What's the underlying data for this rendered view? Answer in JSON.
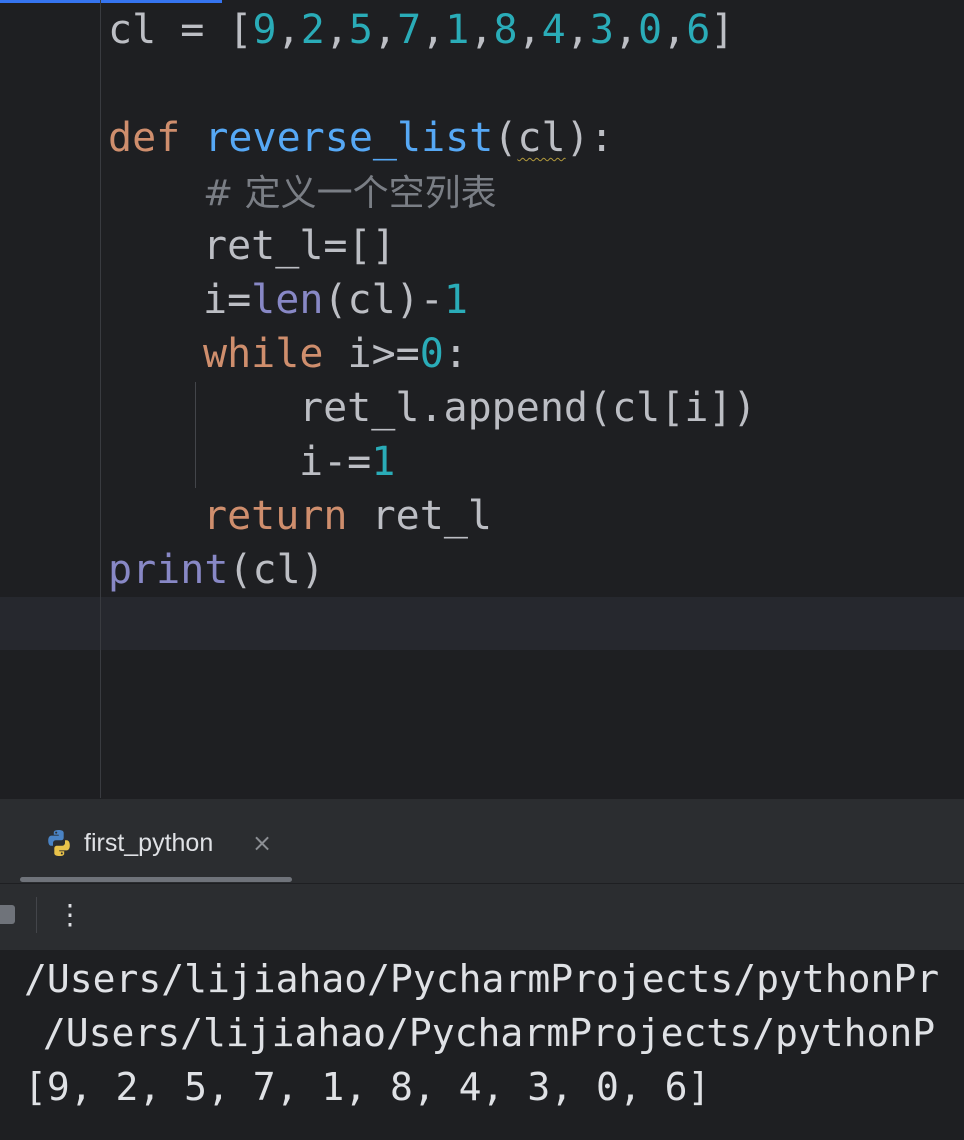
{
  "editor": {
    "line1": {
      "var": "cl",
      "op": " = ",
      "open": "[",
      "items": [
        "9",
        "2",
        "5",
        "7",
        "1",
        "8",
        "4",
        "3",
        "0",
        "6"
      ],
      "sep": ",",
      "close": "]"
    },
    "line2": {
      "kw": "def",
      "name": "reverse_list",
      "open": "(",
      "param": "cl",
      "close": "):"
    },
    "line3": {
      "comment": "# 定义一个空列表"
    },
    "line4": {
      "text": "ret_l=[]"
    },
    "line5": {
      "prefix": "i=",
      "builtin": "len",
      "mid": "(cl)-",
      "num": "1"
    },
    "line6": {
      "kw": "while",
      "mid": " i>=",
      "num": "0",
      "end": ":"
    },
    "line7": {
      "text": "ret_l.append(cl[i])"
    },
    "line8": {
      "prefix": "i-=",
      "num": "1"
    },
    "line9": {
      "kw": "return",
      "rest": " ret_l"
    },
    "line10": {
      "builtin": "print",
      "rest": "(cl)"
    }
  },
  "run_panel": {
    "tab_label": "first_python",
    "close_glyph": "×",
    "more_glyph": "⋮",
    "icons": [
      "python-icon",
      "close-icon",
      "stop-icon",
      "more-vertical-icon"
    ]
  },
  "console": {
    "lines": [
      "/Users/lijiahao/PycharmProjects/pythonPr",
      " /Users/lijiahao/PycharmProjects/pythonP",
      "[9, 2, 5, 7, 1, 8, 4, 3, 0, 6]"
    ]
  },
  "colors": {
    "editor_bg": "#1e1f22",
    "panel_bg": "#2b2d30",
    "keyword": "#cf8e6d",
    "function": "#56a8f5",
    "number": "#2aacb8",
    "builtin": "#8888c6",
    "comment": "#7a7e85",
    "text": "#bcbec4",
    "accent": "#3574f0"
  }
}
